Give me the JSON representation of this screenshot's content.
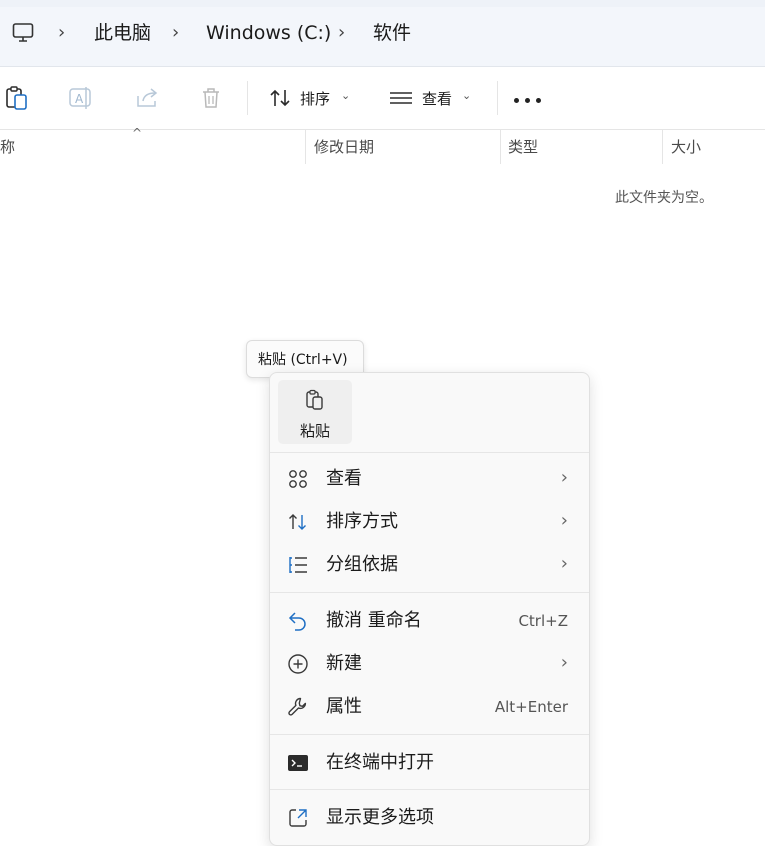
{
  "breadcrumb": {
    "items": [
      "此电脑",
      "Windows (C:)",
      "软件"
    ]
  },
  "toolbar": {
    "sort_label": "排序",
    "view_label": "查看"
  },
  "columns": {
    "name_partial": "称",
    "modified": "修改日期",
    "type": "类型",
    "size": "大小"
  },
  "empty_message": "此文件夹为空。",
  "tooltip": "粘贴 (Ctrl+V)",
  "context_menu": {
    "paste_label": "粘贴",
    "items": [
      {
        "label": "查看",
        "icon": "view-grid-icon",
        "submenu": true
      },
      {
        "label": "排序方式",
        "icon": "sort-icon",
        "submenu": true
      },
      {
        "label": "分组依据",
        "icon": "group-list-icon",
        "submenu": true
      },
      {
        "label": "撤消 重命名",
        "icon": "undo-icon",
        "shortcut": "Ctrl+Z"
      },
      {
        "label": "新建",
        "icon": "new-plus-icon",
        "submenu": true
      },
      {
        "label": "属性",
        "icon": "wrench-icon",
        "shortcut": "Alt+Enter"
      },
      {
        "label": "在终端中打开",
        "icon": "terminal-icon"
      },
      {
        "label": "显示更多选项",
        "icon": "open-external-icon"
      }
    ],
    "submenu_glyph": "›"
  },
  "colors": {
    "address_bar_bg": "#f3f6fb",
    "menu_bg": "#f9f9f9",
    "accent": "#0067c0"
  }
}
